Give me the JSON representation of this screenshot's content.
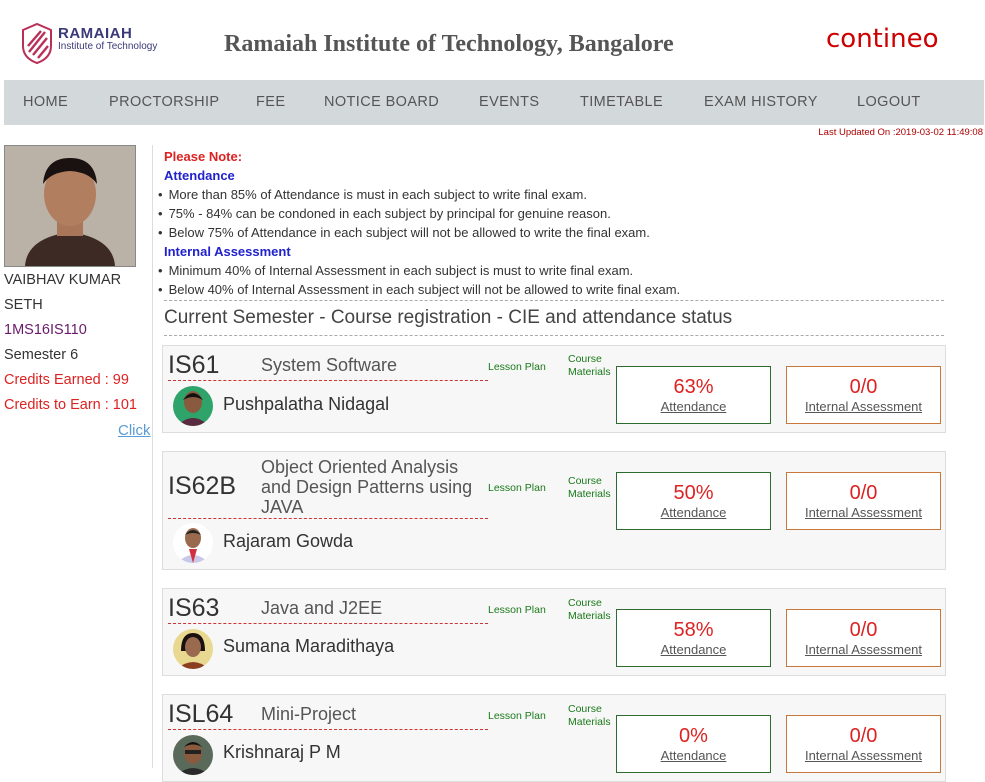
{
  "header": {
    "logo_name": "RAMAIAH",
    "logo_sub": "Institute of Technology",
    "title": "Ramaiah Institute of Technology, Bangalore",
    "brand": "contineo"
  },
  "nav": [
    "HOME",
    "PROCTORSHIP",
    "FEE",
    "NOTICE BOARD",
    "EVENTS",
    "TIMETABLE",
    "EXAM HISTORY",
    "LOGOUT"
  ],
  "last_updated": "Last Updated On :2019-03-02 11:49:08",
  "student": {
    "name_line1": "VAIBHAV KUMAR",
    "name_line2": "SETH",
    "usn": "1MS16IS110",
    "semester": "Semester 6",
    "credits_earned": "Credits Earned : 99",
    "credits_to_earn": "Credits to Earn : 101",
    "click": "Click"
  },
  "notes": {
    "please_note": "Please Note:",
    "attendance_head": "Attendance",
    "attendance": [
      "More than 85% of Attendance is must in each subject to write final exam.",
      "75% - 84% can be condoned in each subject by principal for genuine reason.",
      "Below 75% of Attendance in each subject will not be allowed to write the final exam."
    ],
    "ia_head": "Internal Assessment",
    "ia": [
      "Minimum 40% of Internal Assessment in each subject is must to write final exam.",
      "Below 40% of Internal Assessment in each subject will not be allowed to write final exam."
    ]
  },
  "section_title": "Current Semester - Course registration - CIE and attendance status",
  "labels": {
    "lesson_plan": "Lesson Plan",
    "course_materials_1": "Course",
    "course_materials_2": "Materials",
    "attendance": "Attendance",
    "internal_assessment": "Internal Assessment"
  },
  "courses": [
    {
      "code": "IS61",
      "name_lines": [
        "System Software"
      ],
      "teacher": "Pushpalatha Nidagal",
      "attendance": "63%",
      "ia": "0/0"
    },
    {
      "code": "IS62B",
      "name_lines": [
        "Object Oriented Analysis",
        "and Design Patterns using",
        "JAVA"
      ],
      "teacher": "Rajaram Gowda",
      "attendance": "50%",
      "ia": "0/0"
    },
    {
      "code": "IS63",
      "name_lines": [
        "Java and J2EE"
      ],
      "teacher": "Sumana Maradithaya",
      "attendance": "58%",
      "ia": "0/0"
    },
    {
      "code": "ISL64",
      "name_lines": [
        "Mini-Project"
      ],
      "teacher": "Krishnaraj P M",
      "attendance": "0%",
      "ia": "0/0"
    }
  ],
  "colors": {
    "nav_bg": "#d3d8da",
    "alert_red": "#dd2222",
    "accent_blue": "#2222cc",
    "green": "#2e6b2e",
    "orange": "#c7773a"
  }
}
